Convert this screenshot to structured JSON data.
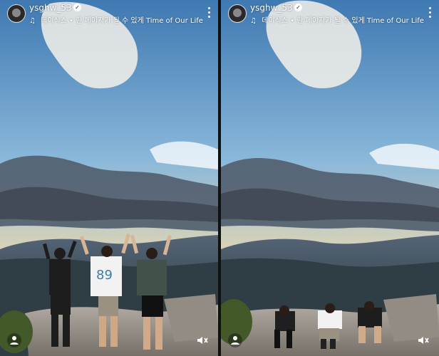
{
  "story": {
    "username": "ysghw_53",
    "music_label": "데이식스 • 한 페이지가 될 수 있게 Time of Our Life",
    "icons": {
      "verified": "verified-badge-icon",
      "music": "music-note-icon",
      "more": "more-vertical-icon",
      "profile": "profile-icon",
      "mute": "mute-icon"
    },
    "numbers": {
      "jersey": "89"
    }
  }
}
